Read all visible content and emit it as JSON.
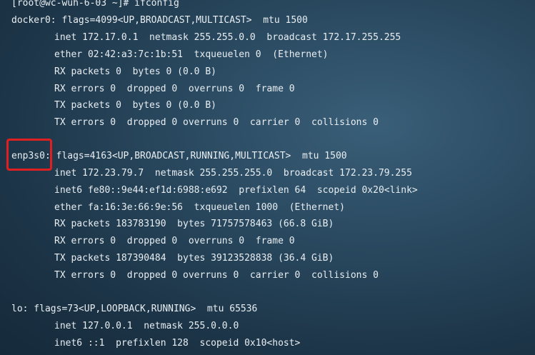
{
  "prompt": "[root@wc-wuh-6-03 ~]# ifconfig",
  "interfaces": {
    "docker0": {
      "header": "docker0: flags=4099<UP,BROADCAST,MULTICAST>  mtu 1500",
      "inet": "inet 172.17.0.1  netmask 255.255.0.0  broadcast 172.17.255.255",
      "ether": "ether 02:42:a3:7c:1b:51  txqueuelen 0  (Ethernet)",
      "rx_packets": "RX packets 0  bytes 0 (0.0 B)",
      "rx_errors": "RX errors 0  dropped 0  overruns 0  frame 0",
      "tx_packets": "TX packets 0  bytes 0 (0.0 B)",
      "tx_errors": "TX errors 0  dropped 0 overruns 0  carrier 0  collisions 0"
    },
    "enp3s0": {
      "name": "enp3s0:",
      "header_rest": " flags=4163<UP,BROADCAST,RUNNING,MULTICAST>  mtu 1500",
      "inet": "inet 172.23.79.7  netmask 255.255.255.0  broadcast 172.23.79.255",
      "inet6": "inet6 fe80::9e44:ef1d:6988:e692  prefixlen 64  scopeid 0x20<link>",
      "ether": "ether fa:16:3e:66:9e:56  txqueuelen 1000  (Ethernet)",
      "rx_packets": "RX packets 183783190  bytes 71757578463 (66.8 GiB)",
      "rx_errors": "RX errors 0  dropped 0  overruns 0  frame 0",
      "tx_packets": "TX packets 187390484  bytes 39123528838 (36.4 GiB)",
      "tx_errors": "TX errors 0  dropped 0 overruns 0  carrier 0  collisions 0"
    },
    "lo": {
      "header": "lo: flags=73<UP,LOOPBACK,RUNNING>  mtu 65536",
      "inet": "inet 127.0.0.1  netmask 255.0.0.0",
      "inet6": "inet6 ::1  prefixlen 128  scopeid 0x10<host>"
    }
  },
  "colors": {
    "highlight_box": "#e02020",
    "text": "#e8eef2"
  }
}
